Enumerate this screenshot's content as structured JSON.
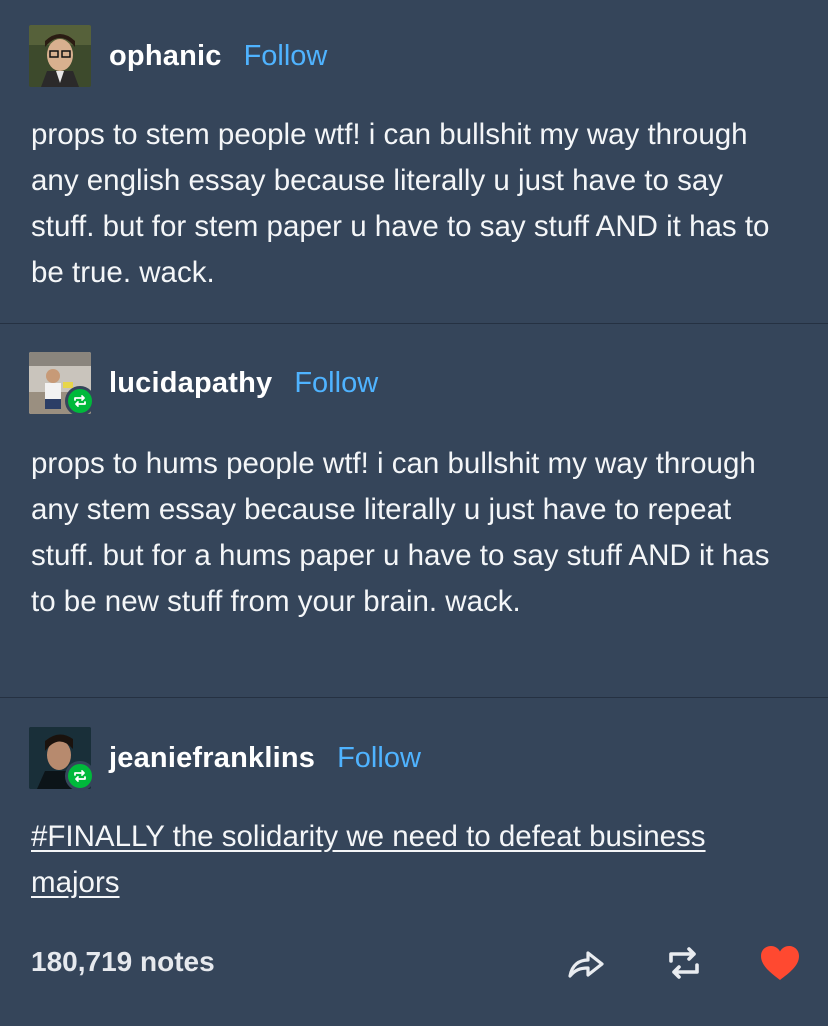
{
  "posts": [
    {
      "username": "ophanic",
      "follow_label": "Follow",
      "text": "props to stem people wtf! i can bullshit my way through any english essay because literally u just have to say stuff. but for stem paper u have to say stuff AND it has to be true. wack."
    },
    {
      "username": "lucidapathy",
      "follow_label": "Follow",
      "text": "props to hums people wtf! i can bullshit my way through any stem essay because literally u just have to repeat stuff. but for a hums paper u have to say stuff AND it has to be new stuff from your brain. wack."
    },
    {
      "username": "jeaniefranklins",
      "follow_label": "Follow",
      "text": "#FINALLY the solidarity we need to defeat business majors"
    }
  ],
  "footer": {
    "notes": "180,719 notes"
  },
  "icons": {
    "share": "share-icon",
    "reblog": "reblog-icon",
    "like": "heart-icon"
  },
  "colors": {
    "background": "#35455a",
    "follow": "#4fb3ff",
    "reblog_badge": "#00b93b",
    "heart": "#ff4930"
  }
}
